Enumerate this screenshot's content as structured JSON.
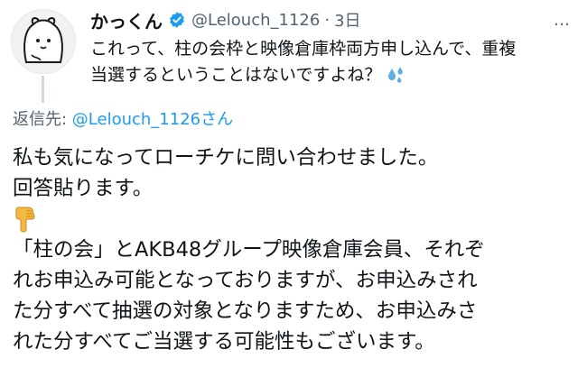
{
  "parent_post": {
    "author": "かっくん",
    "handle": "@Lelouch_1126",
    "separator": "·",
    "time": "3日",
    "more_label": "…",
    "text_lines": [
      "これって、柱の会枠と映像倉庫枠両方申し込んで、重複",
      "当選するということはないですよね？"
    ]
  },
  "reply": {
    "reply_to_prefix": "返信先: ",
    "reply_to_handle": "@Lelouch_1126さん",
    "lines": [
      "私も気になってローチケに問い合わせました。",
      "回答貼ります。",
      "「柱の会」とAKB48グループ映像倉庫会員、それぞ",
      "れお申込み可能となっておりますが、お申込みされ",
      "た分すべて抽選の対象となりますため、お申込みさ",
      "れた分すべてご当選する可能性もございます。"
    ]
  },
  "icons": {
    "verified": "verified-badge-icon",
    "sweat": "sweat-droplets-emoji",
    "pointing": "backhand-index-pointing-down-emoji",
    "more": "more-options-icon"
  },
  "colors": {
    "text": "#0f1419",
    "secondary": "#536471",
    "accent": "#1d9bf0",
    "thread_line": "#cfd9de"
  }
}
